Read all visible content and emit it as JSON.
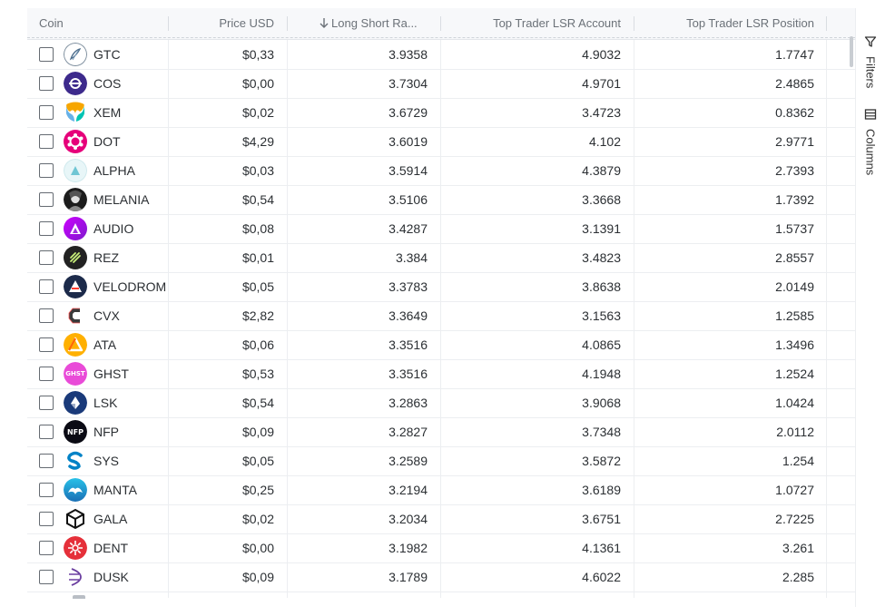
{
  "columns": {
    "coin": "Coin",
    "price": "Price USD",
    "lsr": "Long Short Ra...",
    "top_account": "Top Trader LSR Account",
    "top_position": "Top Trader LSR Position"
  },
  "sidebar": {
    "filters": "Filters",
    "columns": "Columns"
  },
  "rows": [
    {
      "symbol": "GTC",
      "price": "$0,33",
      "lsr": "3.9358",
      "account": "4.9032",
      "position": "1.7747",
      "icon": "gtc-icon"
    },
    {
      "symbol": "COS",
      "price": "$0,00",
      "lsr": "3.7304",
      "account": "4.9701",
      "position": "2.4865",
      "icon": "cos-icon"
    },
    {
      "symbol": "XEM",
      "price": "$0,02",
      "lsr": "3.6729",
      "account": "3.4723",
      "position": "0.8362",
      "icon": "xem-icon"
    },
    {
      "symbol": "DOT",
      "price": "$4,29",
      "lsr": "3.6019",
      "account": "4.102",
      "position": "2.9771",
      "icon": "dot-icon"
    },
    {
      "symbol": "ALPHA",
      "price": "$0,03",
      "lsr": "3.5914",
      "account": "4.3879",
      "position": "2.7393",
      "icon": "alpha-icon"
    },
    {
      "symbol": "MELANIA",
      "price": "$0,54",
      "lsr": "3.5106",
      "account": "3.3668",
      "position": "1.7392",
      "icon": "melania-icon"
    },
    {
      "symbol": "AUDIO",
      "price": "$0,08",
      "lsr": "3.4287",
      "account": "3.1391",
      "position": "1.5737",
      "icon": "audio-icon"
    },
    {
      "symbol": "REZ",
      "price": "$0,01",
      "lsr": "3.384",
      "account": "3.4823",
      "position": "2.8557",
      "icon": "rez-icon"
    },
    {
      "symbol": "VELODROM",
      "price": "$0,05",
      "lsr": "3.3783",
      "account": "3.8638",
      "position": "2.0149",
      "icon": "velodrome-icon"
    },
    {
      "symbol": "CVX",
      "price": "$2,82",
      "lsr": "3.3649",
      "account": "3.1563",
      "position": "1.2585",
      "icon": "cvx-icon"
    },
    {
      "symbol": "ATA",
      "price": "$0,06",
      "lsr": "3.3516",
      "account": "4.0865",
      "position": "1.3496",
      "icon": "ata-icon"
    },
    {
      "symbol": "GHST",
      "price": "$0,53",
      "lsr": "3.3516",
      "account": "4.1948",
      "position": "1.2524",
      "icon": "ghst-icon"
    },
    {
      "symbol": "LSK",
      "price": "$0,54",
      "lsr": "3.2863",
      "account": "3.9068",
      "position": "1.0424",
      "icon": "lsk-icon"
    },
    {
      "symbol": "NFP",
      "price": "$0,09",
      "lsr": "3.2827",
      "account": "3.7348",
      "position": "2.0112",
      "icon": "nfp-icon"
    },
    {
      "symbol": "SYS",
      "price": "$0,05",
      "lsr": "3.2589",
      "account": "3.5872",
      "position": "1.254",
      "icon": "sys-icon"
    },
    {
      "symbol": "MANTA",
      "price": "$0,25",
      "lsr": "3.2194",
      "account": "3.6189",
      "position": "1.0727",
      "icon": "manta-icon"
    },
    {
      "symbol": "GALA",
      "price": "$0,02",
      "lsr": "3.2034",
      "account": "3.6751",
      "position": "2.7225",
      "icon": "gala-icon"
    },
    {
      "symbol": "DENT",
      "price": "$0,00",
      "lsr": "3.1982",
      "account": "4.1361",
      "position": "3.261",
      "icon": "dent-icon"
    },
    {
      "symbol": "DUSK",
      "price": "$0,09",
      "lsr": "3.1789",
      "account": "4.6022",
      "position": "2.285",
      "icon": "dusk-icon"
    }
  ]
}
